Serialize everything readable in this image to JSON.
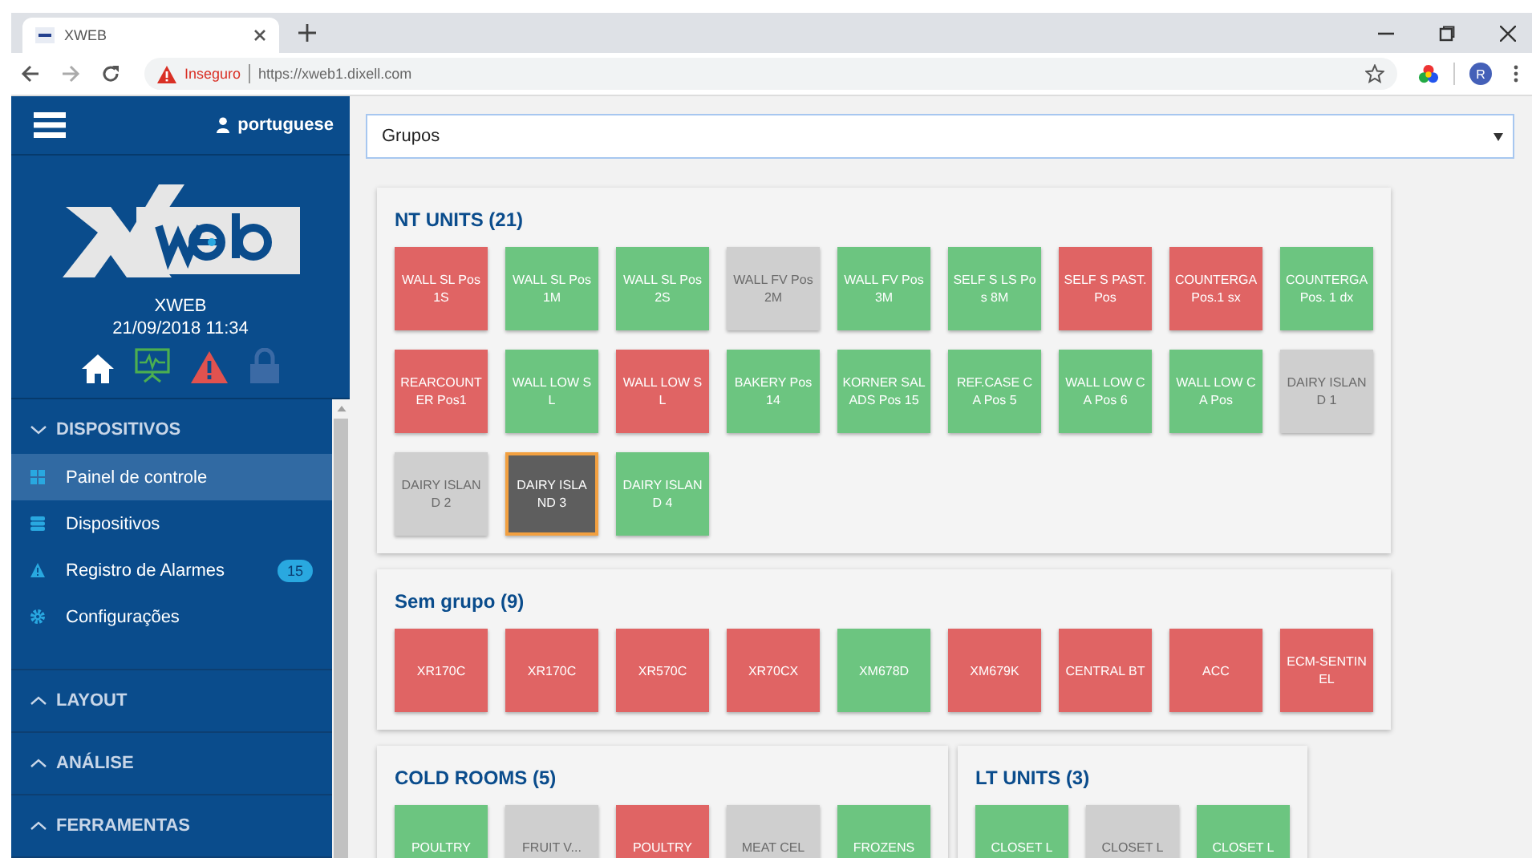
{
  "browser": {
    "tab_title": "XWEB",
    "security": "Inseguro",
    "url": "https://xweb1.dixell.com",
    "profile_initial": "R"
  },
  "sidebar": {
    "user": "portuguese",
    "device_name": "XWEB",
    "datetime": "21/09/2018 11:34",
    "sections": [
      {
        "title": "DISPOSITIVOS",
        "expanded": true,
        "items": [
          {
            "label": "Painel de controle",
            "selected": true
          },
          {
            "label": "Dispositivos",
            "selected": false
          },
          {
            "label": "Registro de Alarmes",
            "selected": false,
            "badge": "15"
          },
          {
            "label": "Configurações",
            "selected": false
          }
        ]
      },
      {
        "title": "LAYOUT",
        "expanded": false
      },
      {
        "title": "ANÁLISE",
        "expanded": false
      },
      {
        "title": "FERRAMENTAS",
        "expanded": false
      }
    ]
  },
  "group_select": {
    "value": "Grupos"
  },
  "groups": [
    {
      "title": "NT UNITS (21)",
      "units": [
        {
          "label": "WALL SL Pos 1S",
          "kind": "alarm",
          "selected": false
        },
        {
          "label": "WALL SL Pos 1M",
          "kind": "ok",
          "selected": false
        },
        {
          "label": "WALL SL Pos 2S",
          "kind": "ok",
          "selected": false
        },
        {
          "label": "WALL FV Pos 2M",
          "kind": "offline",
          "selected": false
        },
        {
          "label": "WALL FV Pos 3M",
          "kind": "ok",
          "selected": false
        },
        {
          "label": "SELF S LS Pos 8M",
          "kind": "ok",
          "selected": false
        },
        {
          "label": "SELF S PAST. Pos",
          "kind": "alarm",
          "selected": false
        },
        {
          "label": "COUNTERGA Pos.1 sx",
          "kind": "alarm",
          "selected": false
        },
        {
          "label": "COUNTERGA Pos. 1 dx",
          "kind": "ok",
          "selected": false
        },
        {
          "label": "REARCOUNTER Pos1",
          "kind": "alarm",
          "selected": false
        },
        {
          "label": "WALL LOW SL",
          "kind": "ok",
          "selected": false
        },
        {
          "label": "WALL LOW SL",
          "kind": "alarm",
          "selected": false
        },
        {
          "label": "BAKERY Pos 14",
          "kind": "ok",
          "selected": false
        },
        {
          "label": "KORNER SALADS Pos 15",
          "kind": "ok",
          "selected": false
        },
        {
          "label": "REF.CASE CA Pos 5",
          "kind": "ok",
          "selected": false
        },
        {
          "label": "WALL LOW CA Pos 6",
          "kind": "ok",
          "selected": false
        },
        {
          "label": "WALL LOW CA Pos",
          "kind": "ok",
          "selected": false
        },
        {
          "label": "DAIRY ISLAND 1",
          "kind": "offline",
          "selected": false
        },
        {
          "label": "DAIRY ISLAND 2",
          "kind": "offline",
          "selected": false
        },
        {
          "label": "DAIRY ISLAND 3",
          "kind": "disabled",
          "selected": true
        },
        {
          "label": "DAIRY ISLAND 4",
          "kind": "ok",
          "selected": false
        }
      ]
    },
    {
      "title": "Sem grupo (9)",
      "units": [
        {
          "label": "XR170C",
          "kind": "alarm",
          "selected": false
        },
        {
          "label": "XR170C",
          "kind": "alarm",
          "selected": false
        },
        {
          "label": "XR570C",
          "kind": "alarm",
          "selected": false
        },
        {
          "label": "XR70CX",
          "kind": "alarm",
          "selected": false
        },
        {
          "label": "XM678D",
          "kind": "ok",
          "selected": false
        },
        {
          "label": "XM679K",
          "kind": "alarm",
          "selected": false
        },
        {
          "label": "CENTRAL BT",
          "kind": "alarm",
          "selected": false
        },
        {
          "label": "ACC",
          "kind": "alarm",
          "selected": false
        },
        {
          "label": "ECM-SENTINEL",
          "kind": "alarm",
          "selected": false
        }
      ]
    },
    {
      "title": "COLD ROOMS (5)",
      "units": [
        {
          "label": "POULTRY",
          "kind": "ok",
          "selected": false
        },
        {
          "label": "FRUIT V...",
          "kind": "offline",
          "selected": false
        },
        {
          "label": "POULTRY",
          "kind": "alarm",
          "selected": false
        },
        {
          "label": "MEAT CEL",
          "kind": "offline",
          "selected": false
        },
        {
          "label": "FROZENS",
          "kind": "ok",
          "selected": false
        }
      ]
    },
    {
      "title": "LT UNITS (3)",
      "units": [
        {
          "label": "CLOSET L",
          "kind": "ok",
          "selected": false
        },
        {
          "label": "CLOSET L",
          "kind": "offline",
          "selected": false
        },
        {
          "label": "CLOSET L",
          "kind": "ok",
          "selected": false
        }
      ]
    }
  ]
}
